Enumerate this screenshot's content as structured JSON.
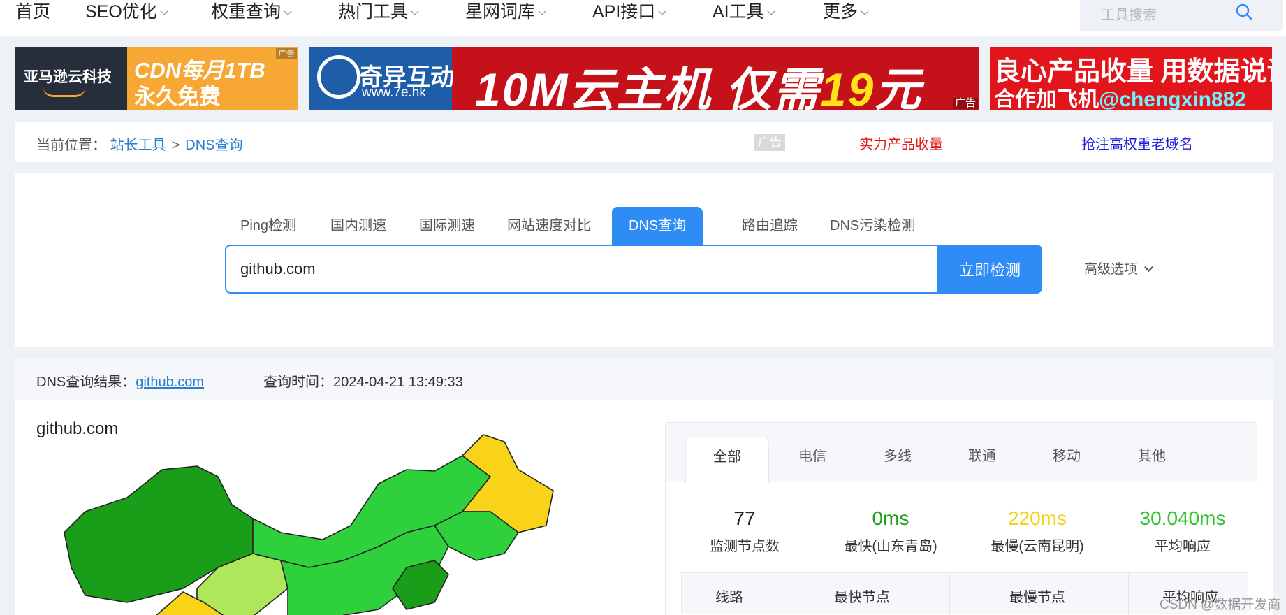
{
  "nav": {
    "items": [
      {
        "label": "首页",
        "dropdown": false
      },
      {
        "label": "SEO优化",
        "dropdown": true
      },
      {
        "label": "权重查询",
        "dropdown": true
      },
      {
        "label": "热门工具",
        "dropdown": true
      },
      {
        "label": "星网词库",
        "dropdown": true
      },
      {
        "label": "API接口",
        "dropdown": true
      },
      {
        "label": "AI工具",
        "dropdown": true
      },
      {
        "label": "更多",
        "dropdown": true
      }
    ],
    "search_placeholder": "工具搜索"
  },
  "banners": {
    "ad_label": "广告",
    "b1": {
      "logo": "亚马逊云科技",
      "line1": "CDN每月1TB",
      "line2": "永久免费"
    },
    "b2": {
      "logo": "奇异互动",
      "url": "www.7e.hk",
      "text_white1": "10M云主机 仅需",
      "text_yellow": "19",
      "text_white2": "元"
    },
    "b3": {
      "line1": "良心产品收量 用数据说话",
      "line2_prefix": "合作加飞机",
      "line2_handle": "@chengxin882"
    }
  },
  "breadcrumb": {
    "prefix": "当前位置：",
    "items": [
      "站长工具",
      "DNS查询"
    ],
    "separator": ">",
    "ad_mark": "广告",
    "ad_link1": "实力产品收量",
    "ad_link2": "抢注高权重老域名"
  },
  "tool": {
    "tabs": [
      "Ping检测",
      "国内测速",
      "国际测速",
      "网站速度对比",
      "DNS查询",
      "路由追踪",
      "DNS污染检测"
    ],
    "active_tab": "DNS查询",
    "input_value": "github.com",
    "button_label": "立即检测",
    "advanced_label": "高级选项"
  },
  "result": {
    "label": "DNS查询结果：",
    "domain": "github.com",
    "time_label": "查询时间：",
    "time": "2024-04-21 13:49:33",
    "map_title": "github.com",
    "isp_tabs": [
      "全部",
      "电信",
      "多线",
      "联通",
      "移动",
      "其他"
    ],
    "active_isp": "全部",
    "stats": [
      {
        "value": "77",
        "label": "监测节点数",
        "color": "#222222"
      },
      {
        "value": "0ms",
        "label": "最快(山东青岛)",
        "color": "#1a9e1a"
      },
      {
        "value": "220ms",
        "label": "最慢(云南昆明)",
        "color": "#f2d21a"
      },
      {
        "value": "30.040ms",
        "label": "平均响应",
        "color": "#2ec22e"
      }
    ],
    "table_headers": [
      "线路",
      "最快节点",
      "最慢节点",
      "平均响应"
    ]
  },
  "colors": {
    "accent": "#2f8cf5",
    "link": "#2b7fd1",
    "map_dark_green": "#1a9e1a",
    "map_green": "#2ed13c",
    "map_light_green": "#aee85a",
    "map_yellow": "#f9d21a"
  },
  "watermark": "CSDN @数据开发商"
}
